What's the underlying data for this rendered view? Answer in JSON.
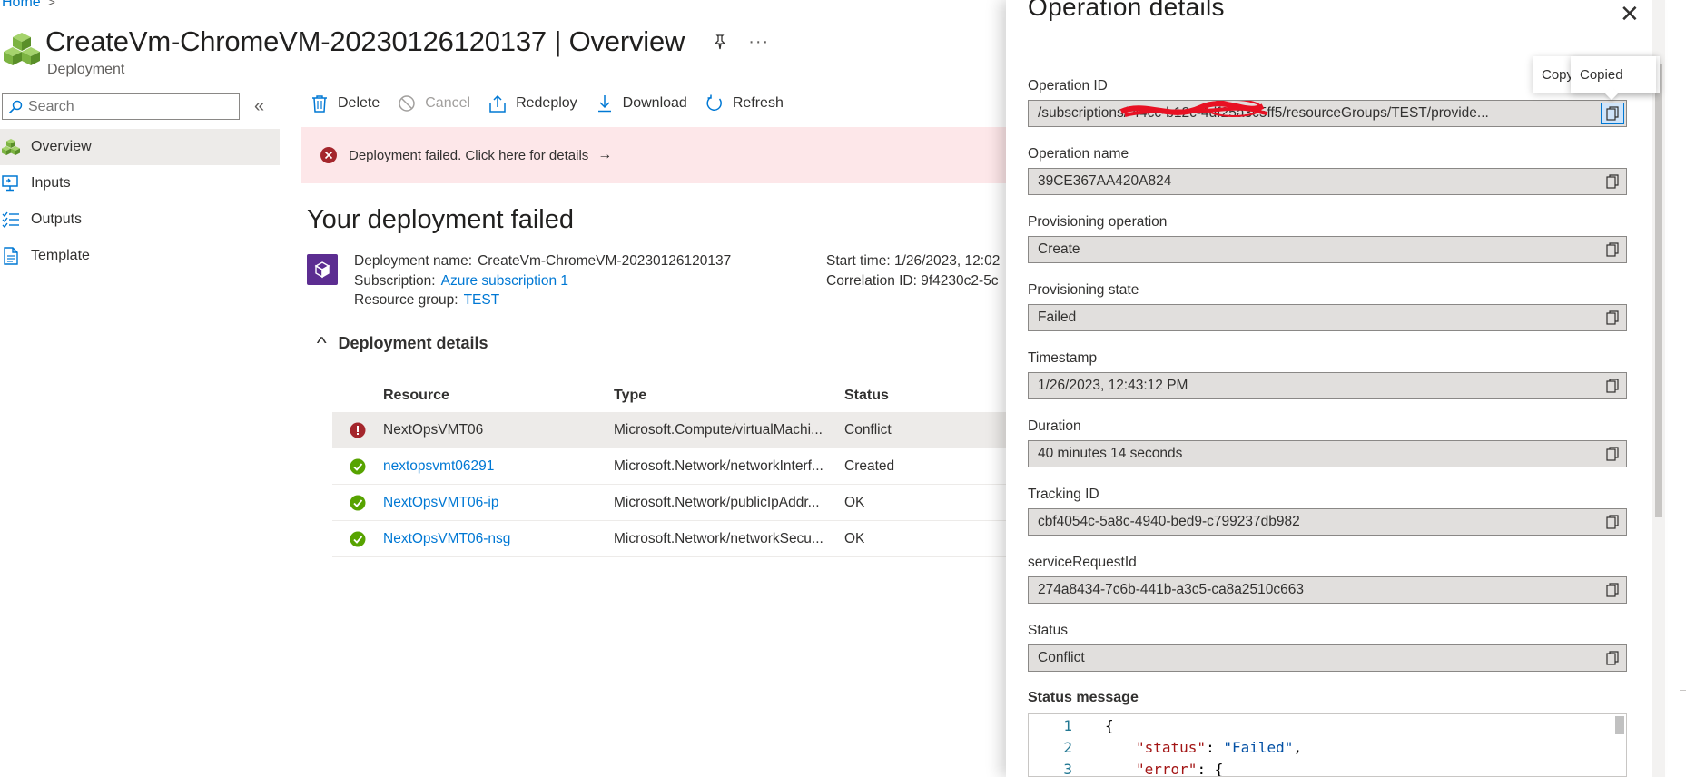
{
  "breadcrumb": {
    "home": "Home",
    "separator": ">"
  },
  "header": {
    "title": "CreateVm-ChromeVM-20230126120137 | Overview",
    "subtitle": "Deployment",
    "more": "···"
  },
  "search": {
    "placeholder": "Search",
    "value": ""
  },
  "collapse_glyph": "«",
  "nav": {
    "items": [
      {
        "label": "Overview",
        "icon": "cubes-icon"
      },
      {
        "label": "Inputs",
        "icon": "inputs-icon"
      },
      {
        "label": "Outputs",
        "icon": "outputs-icon"
      },
      {
        "label": "Template",
        "icon": "template-icon"
      }
    ]
  },
  "toolbar": {
    "delete": "Delete",
    "cancel": "Cancel",
    "redeploy": "Redeploy",
    "download": "Download",
    "refresh": "Refresh"
  },
  "alert": {
    "text": "Deployment failed. Click here for details",
    "arrow": "→"
  },
  "deployment": {
    "heading": "Your deployment failed",
    "name_label": "Deployment name:",
    "name_value": "CreateVm-ChromeVM-20230126120137",
    "subscription_label": "Subscription:",
    "subscription_value": "Azure subscription 1",
    "rg_label": "Resource group:",
    "rg_value": "TEST",
    "start_label": "Start time:",
    "start_value": "1/26/2023, 12:02",
    "corr_label": "Correlation ID:",
    "corr_value": "9f4230c2-5c"
  },
  "details": {
    "label": "Deployment details",
    "chevron": "^",
    "columns": [
      "Resource",
      "Type",
      "Status"
    ],
    "rows": [
      {
        "resource": "NextOpsVMT06",
        "type": "Microsoft.Compute/virtualMachi...",
        "status": "Conflict",
        "state": "error"
      },
      {
        "resource": "nextopsvmt06291",
        "type": "Microsoft.Network/networkInterf...",
        "status": "Created",
        "state": "ok"
      },
      {
        "resource": "NextOpsVMT06-ip",
        "type": "Microsoft.Network/publicIpAddr...",
        "status": "OK",
        "state": "ok"
      },
      {
        "resource": "NextOpsVMT06-nsg",
        "type": "Microsoft.Network/networkSecu...",
        "status": "OK",
        "state": "ok"
      }
    ]
  },
  "blade": {
    "title": "Operation details",
    "close": "✕",
    "fields": [
      {
        "label": "Operation ID",
        "value": "/subscriptions/                        44cc-b12c-4df25a3c5ff5/resourceGroups/TEST/provide..."
      },
      {
        "label": "Operation name",
        "value": "39CE367AA420A824"
      },
      {
        "label": "Provisioning operation",
        "value": "Create"
      },
      {
        "label": "Provisioning state",
        "value": "Failed"
      },
      {
        "label": "Timestamp",
        "value": "1/26/2023, 12:43:12 PM"
      },
      {
        "label": "Duration",
        "value": "40 minutes 14 seconds"
      },
      {
        "label": "Tracking ID",
        "value": "cbf4054c-5a8c-4940-bed9-c799237db982"
      },
      {
        "label": "serviceRequestId",
        "value": "274a8434-7c6b-441b-a3c5-ca8a2510c663"
      },
      {
        "label": "Status",
        "value": "Conflict"
      }
    ],
    "status_message_label": "Status message",
    "code": [
      {
        "n": "1",
        "text": "{"
      },
      {
        "n": "2",
        "key": "\"status\"",
        "sep": ": ",
        "val": "\"Failed\"",
        "end": ","
      },
      {
        "n": "3",
        "key": "\"error\"",
        "sep": ": ",
        "val": "",
        "end": "{"
      }
    ]
  },
  "tooltips": {
    "copy": "Copy",
    "copied": "Copied"
  }
}
